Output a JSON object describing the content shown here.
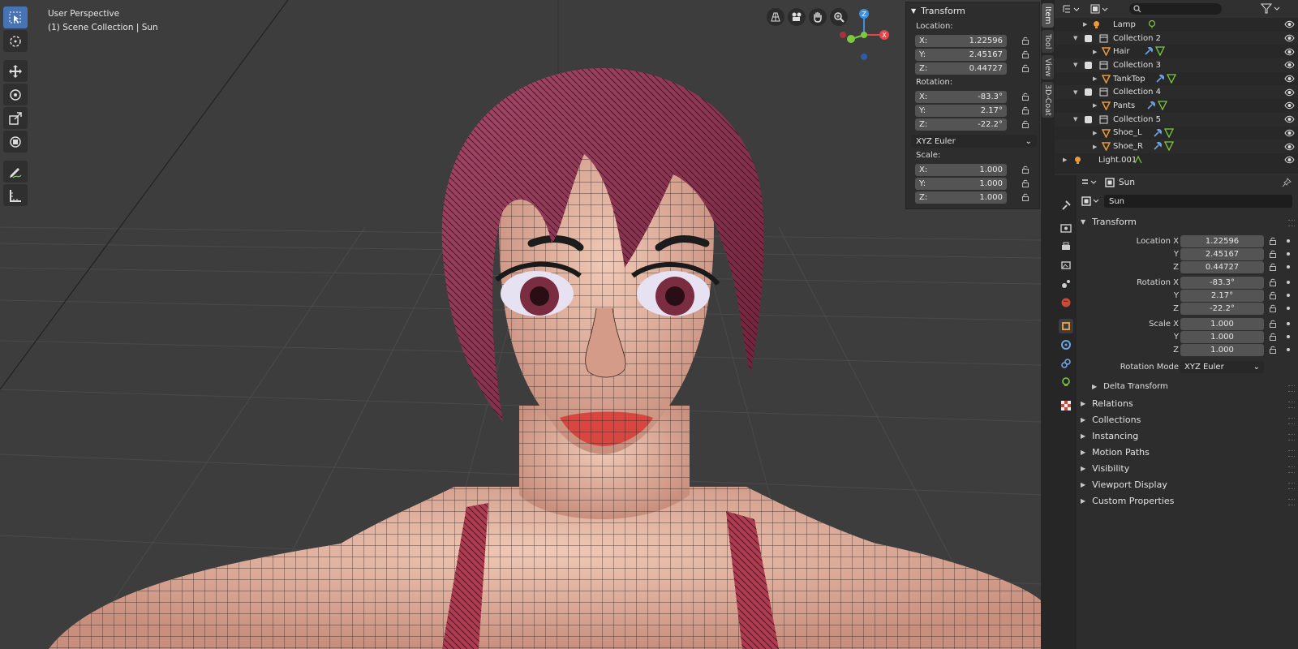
{
  "viewport": {
    "perspective": "User Perspective",
    "collection_info": "(1) Scene Collection | Sun"
  },
  "npanel": {
    "header": "Transform",
    "location_label": "Location:",
    "location": [
      {
        "axis": "X:",
        "value": "1.22596"
      },
      {
        "axis": "Y:",
        "value": "2.45167"
      },
      {
        "axis": "Z:",
        "value": "0.44727"
      }
    ],
    "rotation_label": "Rotation:",
    "rotation": [
      {
        "axis": "X:",
        "value": "-83.3°"
      },
      {
        "axis": "Y:",
        "value": "2.17°"
      },
      {
        "axis": "Z:",
        "value": "-22.2°"
      }
    ],
    "rotation_mode": "XYZ Euler",
    "scale_label": "Scale:",
    "scale": [
      {
        "axis": "X:",
        "value": "1.000"
      },
      {
        "axis": "Y:",
        "value": "1.000"
      },
      {
        "axis": "Z:",
        "value": "1.000"
      }
    ]
  },
  "vertical_tabs": [
    "Item",
    "Tool",
    "View",
    "3D-Coat"
  ],
  "outliner": {
    "rows": [
      {
        "name": "Lamp",
        "type": "light"
      },
      {
        "name": "Collection 2",
        "type": "collection"
      },
      {
        "name": "Hair",
        "type": "mesh"
      },
      {
        "name": "Collection 3",
        "type": "collection"
      },
      {
        "name": "TankTop",
        "type": "mesh"
      },
      {
        "name": "Collection 4",
        "type": "collection"
      },
      {
        "name": "Pants",
        "type": "mesh"
      },
      {
        "name": "Collection 5",
        "type": "collection"
      },
      {
        "name": "Shoe_L",
        "type": "mesh"
      },
      {
        "name": "Shoe_R",
        "type": "mesh"
      },
      {
        "name": "Light.001",
        "type": "light"
      }
    ]
  },
  "properties": {
    "header_object": "Sun",
    "object_name": "Sun",
    "transform_header": "Transform",
    "fields": [
      {
        "label": "Location X",
        "value": "1.22596"
      },
      {
        "label": "Y",
        "value": "2.45167"
      },
      {
        "label": "Z",
        "value": "0.44727"
      },
      {
        "label": "Rotation X",
        "value": "-83.3°"
      },
      {
        "label": "Y",
        "value": "2.17°"
      },
      {
        "label": "Z",
        "value": "-22.2°"
      },
      {
        "label": "Scale X",
        "value": "1.000"
      },
      {
        "label": "Y",
        "value": "1.000"
      },
      {
        "label": "Z",
        "value": "1.000"
      }
    ],
    "rotation_mode_label": "Rotation Mode",
    "rotation_mode_value": "XYZ Euler",
    "delta_transform": "Delta Transform",
    "sections": [
      "Relations",
      "Collections",
      "Instancing",
      "Motion Paths",
      "Visibility",
      "Viewport Display",
      "Custom Properties"
    ]
  },
  "colors": {
    "accent": "#4772b3",
    "hair": "#8a2f4a",
    "skin": "#dba897",
    "axis_x": "#e8444b",
    "axis_y": "#7cc940",
    "axis_z": "#3d8fe2"
  }
}
